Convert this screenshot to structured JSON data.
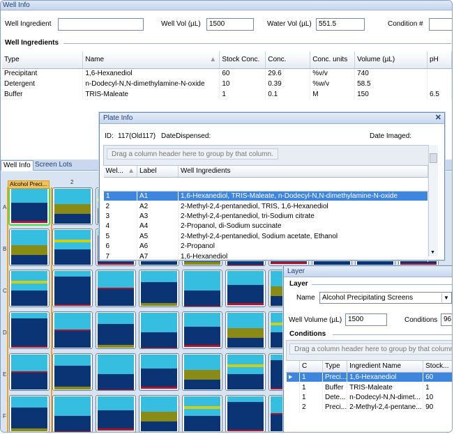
{
  "window_title": "Well Info",
  "fields": {
    "well_ingredient_label": "Well Ingredient",
    "well_ingredient_value": "",
    "well_vol_label": "Well Vol (µL)",
    "well_vol_value": "1500",
    "water_vol_label": "Water Vol (µL)",
    "water_vol_value": "551.5",
    "condition_label": "Condition #",
    "condition_value": ""
  },
  "ingredients": {
    "section_title": "Well Ingredients",
    "columns": [
      "Type",
      "Name",
      "Stock Conc.",
      "Conc.",
      "Conc. units",
      "Volume (µL)",
      "pH"
    ],
    "rows": [
      [
        "Precipitant",
        "1,6-Hexanediol",
        "60",
        "29.6",
        "%v/v",
        "740",
        ""
      ],
      [
        "Detergent",
        "n-Dodecyl-N,N-dimethylamine-N-oxide",
        "10",
        "0.39",
        "%w/v",
        "58.5",
        ""
      ],
      [
        "Buffer",
        "TRIS-Maleate",
        "1",
        "0.1",
        "M",
        "150",
        "6.5"
      ]
    ]
  },
  "tabs": [
    "Well Info",
    "Screen Lots"
  ],
  "plate": {
    "selected_tab_label": "Alcohol Preci...",
    "column_label": "2",
    "row_labels": [
      "A",
      "B",
      "C",
      "D",
      "E",
      "F"
    ]
  },
  "plate_info": {
    "title": "Plate Info",
    "close": "✕",
    "id_label": "ID:",
    "id_value": "117(Old117)",
    "date_dispensed_label": "DateDispensed:",
    "date_imaged_label": "Date Imaged:",
    "group_hint": "Drag a column header here to group by that column.",
    "columns": [
      "Wel...",
      "Label",
      "Well Ingredients"
    ],
    "rows": [
      [
        "1",
        "A1",
        "1,6-Hexanediol, TRIS-Maleate, n-Dodecyl-N,N-dimethylamine-N-oxide"
      ],
      [
        "2",
        "A2",
        "2-Methyl-2,4-pentanediol, TRIS, 1,6-Hexanediol"
      ],
      [
        "3",
        "A3",
        "2-Methyl-2,4-pentanediol, tri-Sodium citrate"
      ],
      [
        "4",
        "A4",
        "2-Propanol, di-Sodium succinate"
      ],
      [
        "5",
        "A5",
        "2-Methyl-2,4-pentanediol, Sodium acetate, Ethanol"
      ],
      [
        "6",
        "A6",
        "2-Propanol"
      ],
      [
        "7",
        "A7",
        "1,6-Hexanediol"
      ]
    ]
  },
  "layer": {
    "title": "Layer",
    "section_title": "Layer",
    "name_label": "Name",
    "name_value": "Alcohol Precipitating Screens",
    "well_volume_label": "Well Volume (µL)",
    "well_volume_value": "1500",
    "conditions_label": "Conditions",
    "conditions_value": "96",
    "conditions_section": "Conditions",
    "group_hint": "Drag a column header here to group by that column.",
    "columns": [
      "C",
      "Type",
      "Ingredient Name",
      "Stock..."
    ],
    "rows": [
      [
        "1",
        "Preci...",
        "1,6-Hexanediol",
        "60"
      ],
      [
        "1",
        "Buffer",
        "TRIS-Maleate",
        "1"
      ],
      [
        "1",
        "Dete...",
        "n-Dodecyl-N,N-dimet...",
        "10"
      ],
      [
        "2",
        "Preci...",
        "2-Methyl-2,4-pentane...",
        "90"
      ]
    ]
  },
  "colors": {
    "light_blue": "#35bedf",
    "navy": "#0b3474",
    "red": "#b0142c",
    "olive": "#8a8a16",
    "yellow": "#cfcf18",
    "pale": "#cfe6ee"
  }
}
